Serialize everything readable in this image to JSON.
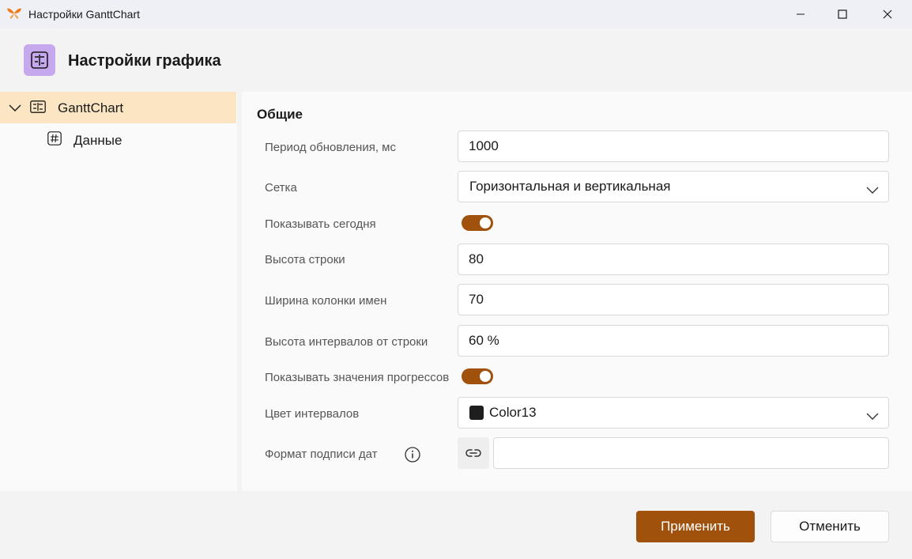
{
  "window": {
    "title": "Настройки GanttChart",
    "app_icon": "butterfly-logo-icon",
    "accent_color": "#a0520c"
  },
  "header": {
    "title": "Настройки графика",
    "icon": "gantt-settings-icon"
  },
  "tree": {
    "items": [
      {
        "label": "GanttChart",
        "icon": "gantt-chart-icon",
        "expanded": true,
        "selected": true
      },
      {
        "label": "Данные",
        "icon": "hash-icon",
        "selected": false
      }
    ]
  },
  "settings": {
    "section_title": "Общие",
    "rows": [
      {
        "label": "Период обновления, мс",
        "type": "number",
        "value": "1000"
      },
      {
        "label": "Сетка",
        "type": "select",
        "value": "Горизонтальная и вертикальная"
      },
      {
        "label": "Показывать сегодня",
        "type": "toggle",
        "value": true
      },
      {
        "label": "Высота строки",
        "type": "number",
        "value": "80"
      },
      {
        "label": "Ширина колонки имен",
        "type": "number",
        "value": "70"
      },
      {
        "label": "Высота интервалов от строки",
        "type": "number",
        "value": "60 %"
      },
      {
        "label": "Показывать значения прогрессов",
        "type": "toggle",
        "value": true
      },
      {
        "label": "Цвет интервалов",
        "type": "color-select",
        "value": "Color13",
        "swatch": "#1e1e1e"
      },
      {
        "label": "Формат подписи дат",
        "type": "text-with-link",
        "value": ""
      }
    ]
  },
  "footer": {
    "apply_label": "Применить",
    "cancel_label": "Отменить"
  }
}
